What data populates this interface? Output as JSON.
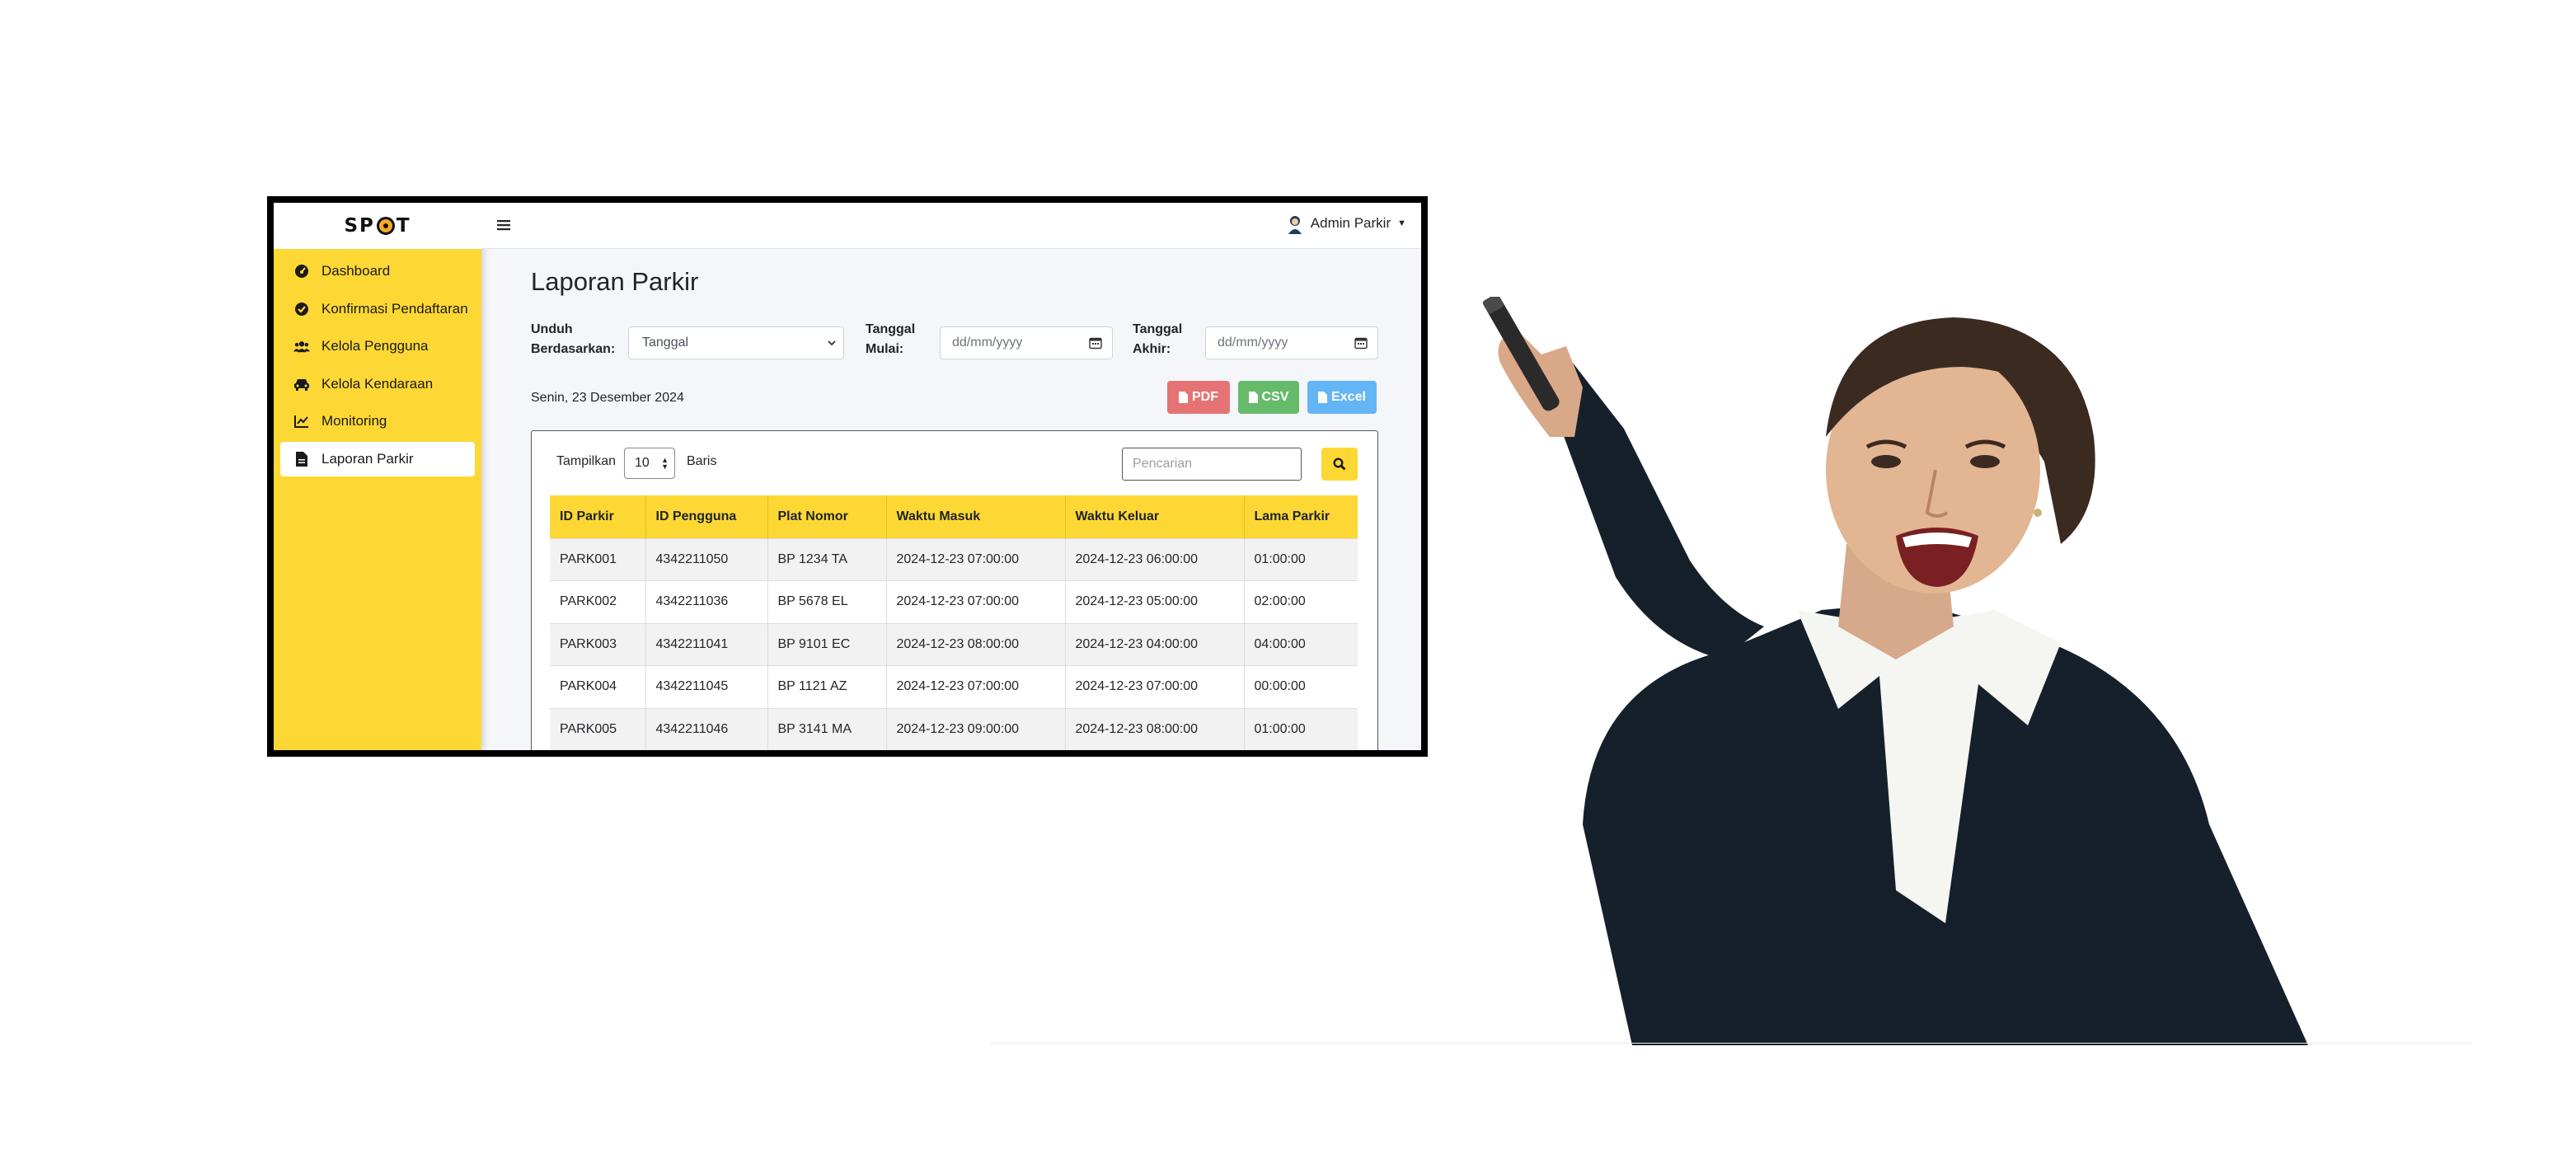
{
  "brand": {
    "logo_text_left": "SP",
    "logo_text_right": "T"
  },
  "sidebar": {
    "items": [
      {
        "label": "Dashboard",
        "icon": "gauge-icon"
      },
      {
        "label": "Konfirmasi Pendaftaran",
        "icon": "check-circle-icon"
      },
      {
        "label": "Kelola Pengguna",
        "icon": "users-icon"
      },
      {
        "label": "Kelola Kendaraan",
        "icon": "car-icon"
      },
      {
        "label": "Monitoring",
        "icon": "line-chart-icon"
      },
      {
        "label": "Laporan Parkir",
        "icon": "file-icon",
        "active": true
      }
    ]
  },
  "topbar": {
    "user_name": "Admin Parkir"
  },
  "page": {
    "title": "Laporan Parkir",
    "filter_label_1": "Unduh",
    "filter_label_2": "Berdasarkan:",
    "filter_value": "Tanggal",
    "start_label_1": "Tanggal",
    "start_label_2": "Mulai:",
    "start_placeholder": "dd/mm/yyyy",
    "end_label_1": "Tanggal",
    "end_label_2": "Akhir:",
    "end_placeholder": "dd/mm/yyyy",
    "current_date": "Senin, 23 Desember 2024",
    "btn_pdf": "PDF",
    "btn_csv": "CSV",
    "btn_excel": "Excel"
  },
  "table_controls": {
    "show_label": "Tampilkan",
    "length_value": "10",
    "rows_label": "Baris",
    "search_placeholder": "Pencarian"
  },
  "table": {
    "headers": [
      "ID Parkir",
      "ID Pengguna",
      "Plat Nomor",
      "Waktu Masuk",
      "Waktu Keluar",
      "Lama Parkir"
    ],
    "rows": [
      [
        "PARK001",
        "4342211050",
        "BP 1234 TA",
        "2024-12-23 07:00:00",
        "2024-12-23 06:00:00",
        "01:00:00"
      ],
      [
        "PARK002",
        "4342211036",
        "BP 5678 EL",
        "2024-12-23 07:00:00",
        "2024-12-23 05:00:00",
        "02:00:00"
      ],
      [
        "PARK003",
        "4342211041",
        "BP 9101 EC",
        "2024-12-23 08:00:00",
        "2024-12-23 04:00:00",
        "04:00:00"
      ],
      [
        "PARK004",
        "4342211045",
        "BP 1121 AZ",
        "2024-12-23 07:00:00",
        "2024-12-23 07:00:00",
        "00:00:00"
      ],
      [
        "PARK005",
        "4342211046",
        "BP 3141 MA",
        "2024-12-23 09:00:00",
        "2024-12-23 08:00:00",
        "01:00:00"
      ]
    ]
  },
  "colors": {
    "accent_yellow": "#fdd835",
    "pdf": "#e57373",
    "csv": "#66bb6a",
    "excel": "#64b5f6"
  }
}
